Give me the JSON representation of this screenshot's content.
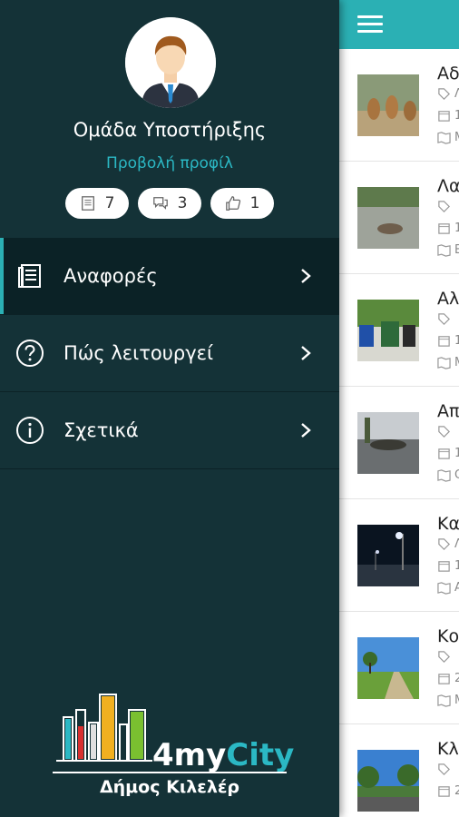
{
  "drawer": {
    "user_name": "Ομάδα Υποστήριξης",
    "view_profile": "Προβολή προφίλ",
    "stats": [
      {
        "icon": "reports-icon",
        "value": "7"
      },
      {
        "icon": "comments-icon",
        "value": "3"
      },
      {
        "icon": "like-icon",
        "value": "1"
      }
    ],
    "menu": [
      {
        "label": "Αναφορές",
        "icon": "reports-icon",
        "active": true
      },
      {
        "label": "Πώς λειτουργεί",
        "icon": "help-icon",
        "active": false
      },
      {
        "label": "Σχετικά",
        "icon": "info-icon",
        "active": false
      }
    ],
    "logo": {
      "brand_prefix": "4my",
      "brand_suffix": "City",
      "municipality": "Δήμος Κιλελέρ"
    }
  },
  "content": {
    "items": [
      {
        "title": "Αδ",
        "meta": [
          "Λ",
          "1",
          "Μ"
        ],
        "thumb": "dogs"
      },
      {
        "title": "Λα",
        "meta": [
          "",
          "1",
          "Ε"
        ],
        "thumb": "pothole"
      },
      {
        "title": "Αλ",
        "meta": [
          "",
          "1",
          "Μ"
        ],
        "thumb": "bins"
      },
      {
        "title": "Απ",
        "meta": [
          "",
          "1",
          "Ο"
        ],
        "thumb": "debris"
      },
      {
        "title": "Κα",
        "meta": [
          "Λ",
          "1",
          "Α"
        ],
        "thumb": "streetlight"
      },
      {
        "title": "Κο",
        "meta": [
          "",
          "2",
          "Μ"
        ],
        "thumb": "road"
      },
      {
        "title": "Κλ",
        "meta": [
          "",
          "2",
          ""
        ],
        "thumb": "park"
      }
    ]
  },
  "colors": {
    "drawer_bg": "#143237",
    "accent": "#2bb0b4",
    "active_item": "#0b2226"
  }
}
